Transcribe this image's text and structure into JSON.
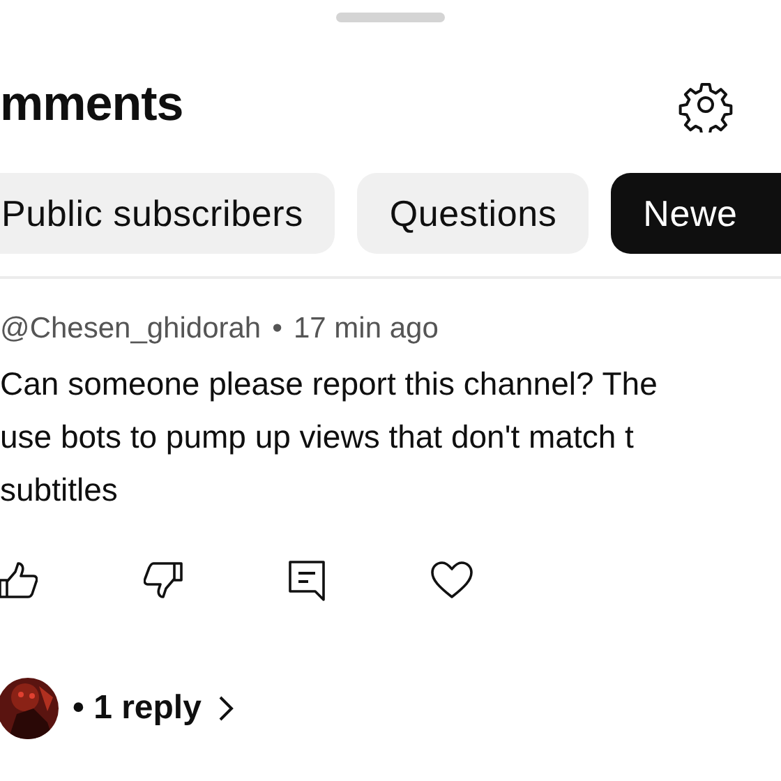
{
  "header": {
    "title": "mments"
  },
  "chips": [
    {
      "label": "Public subscribers",
      "selected": false
    },
    {
      "label": "Questions",
      "selected": false
    },
    {
      "label": "Newe",
      "selected": true
    }
  ],
  "comment": {
    "author": "@Chesen_ghidorah",
    "separator": "•",
    "time": "17 min ago",
    "lines": [
      "Can someone please report this channel? The",
      "use bots to pump up views that don't match t",
      "subtitles"
    ],
    "replies": "• 1 reply"
  }
}
